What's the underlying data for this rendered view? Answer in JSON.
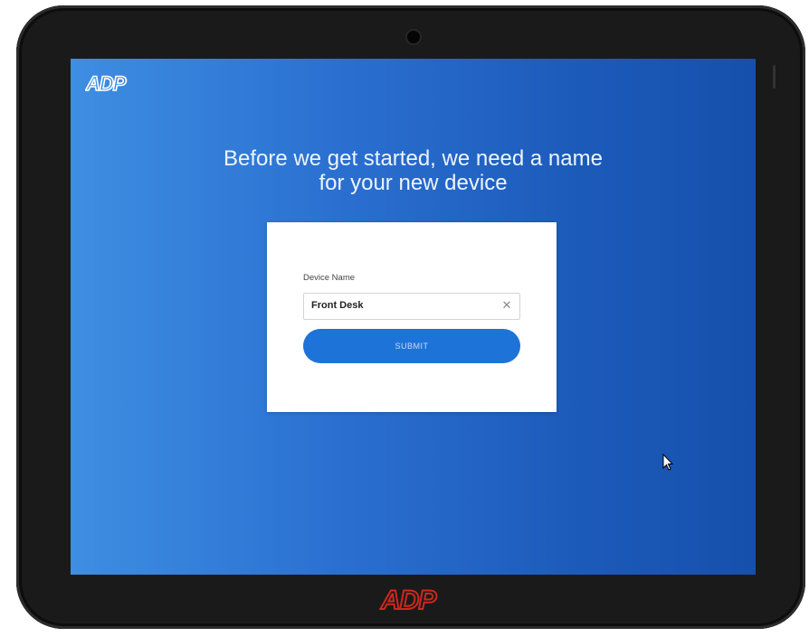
{
  "brand": {
    "logo_text": "ADP",
    "screen_logo_color": "#ffffff",
    "bezel_logo_color": "#d0271d"
  },
  "device_setup": {
    "heading_line1": "Before we get started, we need a name",
    "heading_line2": "for your new device",
    "field_label": "Device Name",
    "field_value": "Front Desk",
    "clear_icon": "close-icon",
    "submit_label": "SUBMIT"
  },
  "colors": {
    "accent": "#1e73d8",
    "background_start": "#3e8ee2",
    "background_end": "#1650ac"
  }
}
